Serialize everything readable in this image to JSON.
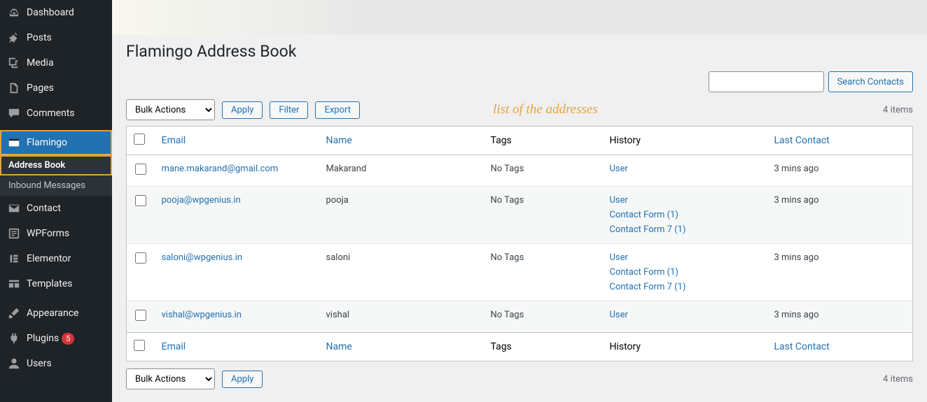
{
  "sidebar": {
    "items": [
      {
        "label": "Dashboard",
        "icon": "dashboard"
      },
      {
        "label": "Posts",
        "icon": "pin"
      },
      {
        "label": "Media",
        "icon": "media"
      },
      {
        "label": "Pages",
        "icon": "page"
      },
      {
        "label": "Comments",
        "icon": "comment"
      },
      {
        "label": "Flamingo",
        "icon": "flamingo",
        "active": true,
        "highlighted": true
      },
      {
        "label": "Contact",
        "icon": "mail"
      },
      {
        "label": "WPForms",
        "icon": "wpforms"
      },
      {
        "label": "Elementor",
        "icon": "elementor"
      },
      {
        "label": "Templates",
        "icon": "templates"
      },
      {
        "label": "Appearance",
        "icon": "brush"
      },
      {
        "label": "Plugins",
        "icon": "plugin",
        "badge": "5"
      },
      {
        "label": "Users",
        "icon": "user"
      }
    ],
    "submenu": [
      {
        "label": "Address Book",
        "active": true,
        "highlighted": true
      },
      {
        "label": "Inbound Messages"
      }
    ]
  },
  "page": {
    "title": "Flamingo Address Book",
    "search_button": "Search Contacts",
    "bulk_actions": "Bulk Actions",
    "apply": "Apply",
    "filter": "Filter",
    "export": "Export",
    "annotation": "list of the addresses",
    "item_count": "4 items"
  },
  "table": {
    "columns": {
      "email": "Email",
      "name": "Name",
      "tags": "Tags",
      "history": "History",
      "last_contact": "Last Contact"
    },
    "rows": [
      {
        "email": "mane.makarand@gmail.com",
        "name": "Makarand",
        "tags": "No Tags",
        "history": [
          "User"
        ],
        "last_contact": "3 mins ago"
      },
      {
        "email": "pooja@wpgenius.in",
        "name": "pooja",
        "tags": "No Tags",
        "history": [
          "User",
          "Contact Form (1)",
          "Contact Form 7 (1)"
        ],
        "last_contact": "3 mins ago"
      },
      {
        "email": "saloni@wpgenius.in",
        "name": "saloni",
        "tags": "No Tags",
        "history": [
          "User",
          "Contact Form (1)",
          "Contact Form 7 (1)"
        ],
        "last_contact": "3 mins ago"
      },
      {
        "email": "vishal@wpgenius.in",
        "name": "vishal",
        "tags": "No Tags",
        "history": [
          "User"
        ],
        "last_contact": "3 mins ago"
      }
    ]
  }
}
